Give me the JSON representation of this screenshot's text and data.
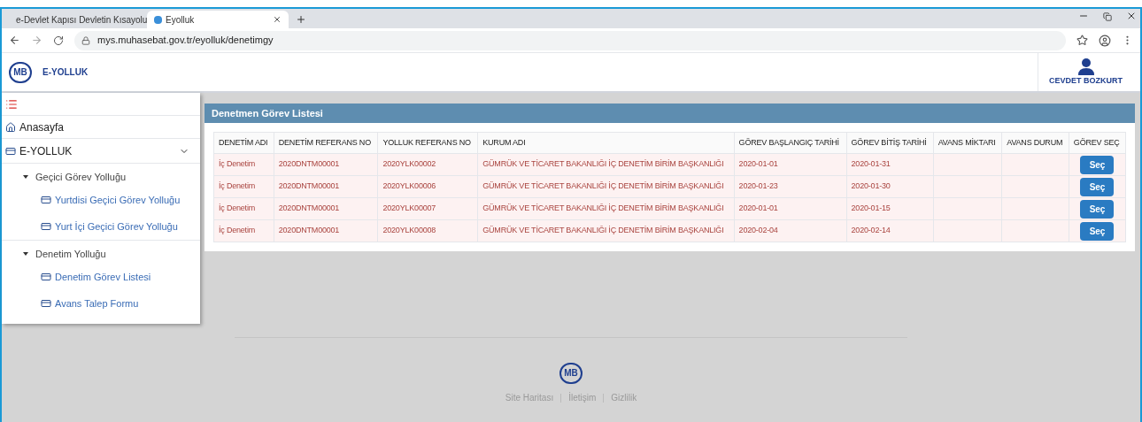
{
  "browser": {
    "tabs": [
      {
        "label": "e-Devlet Kapısı Devletin Kısayolu",
        "selected": false
      },
      {
        "label": "Eyolluk",
        "selected": true
      }
    ],
    "url": "mys.muhasebat.gov.tr/eyolluk/denetimgy"
  },
  "header": {
    "logo": "MB",
    "title": "E-YOLLUK",
    "user": "CEVDET BOZKURT"
  },
  "sidebar": {
    "items": [
      {
        "kind": "home",
        "label": "Anasayfa"
      },
      {
        "kind": "section",
        "label": "E-YOLLUK",
        "expanded": true,
        "children": [
          {
            "label": "Geçici Görev Yolluğu",
            "expanded": true,
            "children": [
              {
                "label": "Yurtdisi Geçici Görev Yolluğu"
              },
              {
                "label": "Yurt İçi Geçici Görev Yolluğu"
              }
            ]
          },
          {
            "label": "Denetim Yolluğu",
            "expanded": true,
            "children": [
              {
                "label": "Denetim Görev Listesi"
              },
              {
                "label": "Avans Talep Formu"
              }
            ]
          }
        ]
      }
    ]
  },
  "panel": {
    "title": "Denetmen Görev Listesi",
    "table": {
      "columns": [
        "DENETİM ADI",
        "DENETİM REFERANS NO",
        "YOLLUK REFERANS NO",
        "KURUM ADI",
        "GÖREV BAŞLANGIÇ TARİHİ",
        "GÖREV BİTİŞ TARİHİ",
        "AVANS MİKTARI",
        "AVANS DURUM",
        "GÖREV SEÇ"
      ],
      "rows": [
        {
          "cells": [
            "İç Denetim",
            "2020DNTM00001",
            "2020YLK00002",
            "GÜMRÜK VE TİCARET BAKANLIĞI İÇ DENETİM BİRİM BAŞKANLIĞI",
            "2020-01-01",
            "2020-01-31",
            "",
            ""
          ],
          "button": "Seç"
        },
        {
          "cells": [
            "İç Denetim",
            "2020DNTM00001",
            "2020YLK00006",
            "GÜMRÜK VE TİCARET BAKANLIĞI İÇ DENETİM BİRİM BAŞKANLIĞI",
            "2020-01-23",
            "2020-01-30",
            "",
            ""
          ],
          "button": "Seç"
        },
        {
          "cells": [
            "İç Denetim",
            "2020DNTM00001",
            "2020YLK00007",
            "GÜMRÜK VE TİCARET BAKANLIĞI İÇ DENETİM BİRİM BAŞKANLIĞI",
            "2020-01-01",
            "2020-01-15",
            "",
            ""
          ],
          "button": "Seç"
        },
        {
          "cells": [
            "İç Denetim",
            "2020DNTM00001",
            "2020YLK00008",
            "GÜMRÜK VE TİCARET BAKANLIĞI İÇ DENETİM BİRİM BAŞKANLIĞI",
            "2020-02-04",
            "2020-02-14",
            "",
            ""
          ],
          "button": "Seç"
        }
      ]
    }
  },
  "footer": {
    "logo": "MB",
    "links": [
      "Site Haritası",
      "İletişim",
      "Gizlilik"
    ]
  }
}
